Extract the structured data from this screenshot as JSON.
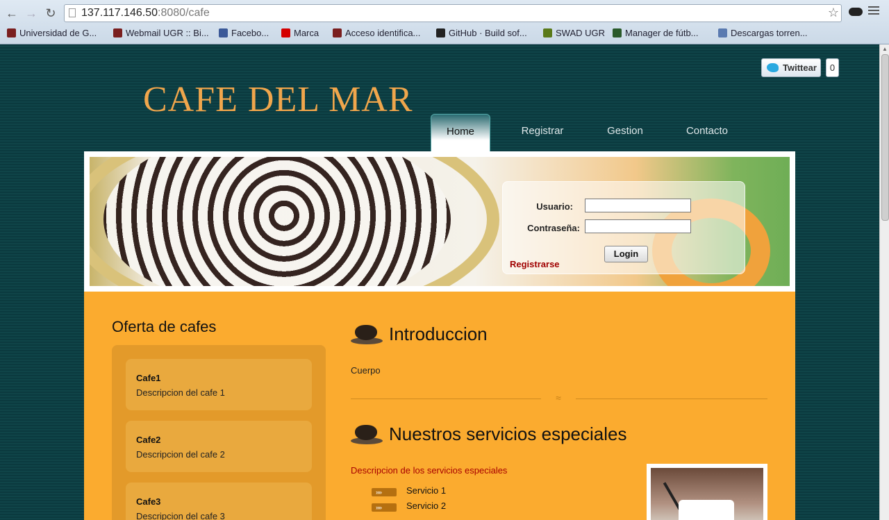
{
  "browser": {
    "url_host": "137.117.146.50",
    "url_rest": ":8080/cafe",
    "bookmarks": [
      {
        "label": "Universidad de G...",
        "color": "#7a1f1f"
      },
      {
        "label": "Webmail UGR :: Bi...",
        "color": "#7a1f1f"
      },
      {
        "label": "Facebo...",
        "color": "#3b5998"
      },
      {
        "label": "Marca",
        "color": "#d40000"
      },
      {
        "label": "Acceso identifica...",
        "color": "#7a1f1f"
      },
      {
        "label": "GitHub · Build sof...",
        "color": "#222222"
      },
      {
        "label": "SWAD UGR",
        "color": "#5a7a1a"
      },
      {
        "label": "Manager de fútb...",
        "color": "#2a5a2a"
      },
      {
        "label": "Descargas torren...",
        "color": "#5a7ab0"
      }
    ]
  },
  "twitter": {
    "label": "Twittear",
    "count": "0"
  },
  "site": {
    "logo": "CAFE DEL MAR"
  },
  "menu": {
    "items": [
      "Home",
      "Registrar",
      "Gestion",
      "Contacto"
    ]
  },
  "login": {
    "user_label": "Usuario:",
    "password_label": "Contraseña:",
    "user_value": "",
    "password_value": "",
    "button": "Login",
    "register_link": "Registrarse"
  },
  "sidebar": {
    "title": "Oferta de cafes",
    "cafes": [
      {
        "name": "Cafe1",
        "desc": "Descripcion del cafe 1"
      },
      {
        "name": "Cafe2",
        "desc": "Descripcion del cafe 2"
      },
      {
        "name": "Cafe3",
        "desc": "Descripcion del cafe 3"
      }
    ]
  },
  "main": {
    "intro_title": "Introduccion",
    "intro_body": "Cuerpo",
    "special_title": "Nuestros servicios especiales",
    "special_desc": "Descripcion de los servicios especiales",
    "services": [
      "Servicio 1",
      "Servicio 2"
    ]
  },
  "colors": {
    "accent": "#fbab2f",
    "logo": "#f0a64c",
    "link": "#a00000"
  }
}
